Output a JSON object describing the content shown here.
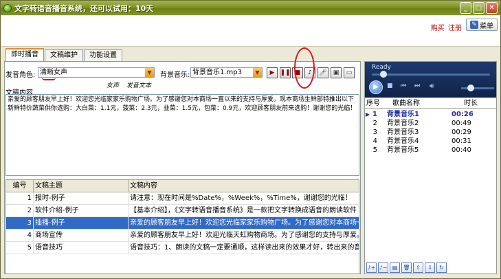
{
  "window": {
    "title": "文字转语音播音系统，还可以试用：10天",
    "buttons": [
      "_",
      "□",
      "✕"
    ]
  },
  "header": {
    "buy_label": "购买",
    "register_label": "注册",
    "menu_label": "菜单"
  },
  "tabs": [
    {
      "label": "即时播音",
      "active": true
    },
    {
      "label": "文稿维护",
      "active": false
    },
    {
      "label": "功能设置",
      "active": false
    }
  ],
  "controls": {
    "role_label": "发音角色:",
    "role_value": "清晰女声",
    "bgm_label": "背景音乐:",
    "bgm_value": "背景音乐1.mp3",
    "hint_1": "女声",
    "hint_2": "发音文本"
  },
  "content": {
    "label": "文稿内容",
    "text": "亲爱的顾客朋友早上好！欢迎您光临家家乐购物广场。为了感谢您对本商场一直以来的支持与厚爱。现本商场生鲜部特推出以下新鲜特价蔬菜供你选购：大白菜：1.1元，菠菜：2.3元，韭菜：1.5元，包菜：0.9元，欢迎顾客朋友前来选购！谢谢您的光临！"
  },
  "grid": {
    "headers": {
      "no": "编号",
      "topic": "文稿主题",
      "body": "文稿内容"
    },
    "rows": [
      {
        "no": "1",
        "topic": "报时-例子",
        "body": "请注意：现在时间是%Date%，%Week%，%Time%，谢谢您的光临！"
      },
      {
        "no": "2",
        "topic": "软件介绍-例子",
        "body": "【基本介绍】，《文字转语音播音系统》是一款把文字转换成语音的朗读软件"
      },
      {
        "no": "3",
        "topic": "插播-例子",
        "body": "亲爱的顾客朋友早上好！欢迎您光临家家乐购物广场。为了感谢您对本商场一直"
      },
      {
        "no": "4",
        "topic": "商场宣传",
        "body": "亲爱的顾客朋友早上好！欢迎光临天虹购物商场。为了感谢您的支持与厚爱。执"
      },
      {
        "no": "5",
        "topic": "语音技巧",
        "body": "语音技巧：1、朗读的文稿一定要通顺，这样读出来的效果才好，转出来的音频"
      }
    ],
    "selected_index": 2
  },
  "player": {
    "status": "Ready",
    "seek_fraction": 0.1,
    "volume_fraction": 0.3
  },
  "playlist": {
    "headers": {
      "no": "序号",
      "name": "歌曲名称",
      "duration": "时长"
    },
    "rows": [
      {
        "no": "1",
        "name": "背景音乐1",
        "duration": "00:26",
        "current": true
      },
      {
        "no": "2",
        "name": "背景音乐2",
        "duration": "00:49",
        "current": false
      },
      {
        "no": "3",
        "name": "背景音乐3",
        "duration": "00:29",
        "current": false
      },
      {
        "no": "4",
        "name": "背景音乐4",
        "duration": "00:31",
        "current": false
      },
      {
        "no": "5",
        "name": "背景音乐5",
        "duration": "00:40",
        "current": false
      }
    ]
  },
  "colors": {
    "title_bar": "#7f9423",
    "selection": "#316ac5",
    "highlight_red": "#e0141e",
    "current_track": "#1a2aa8"
  }
}
